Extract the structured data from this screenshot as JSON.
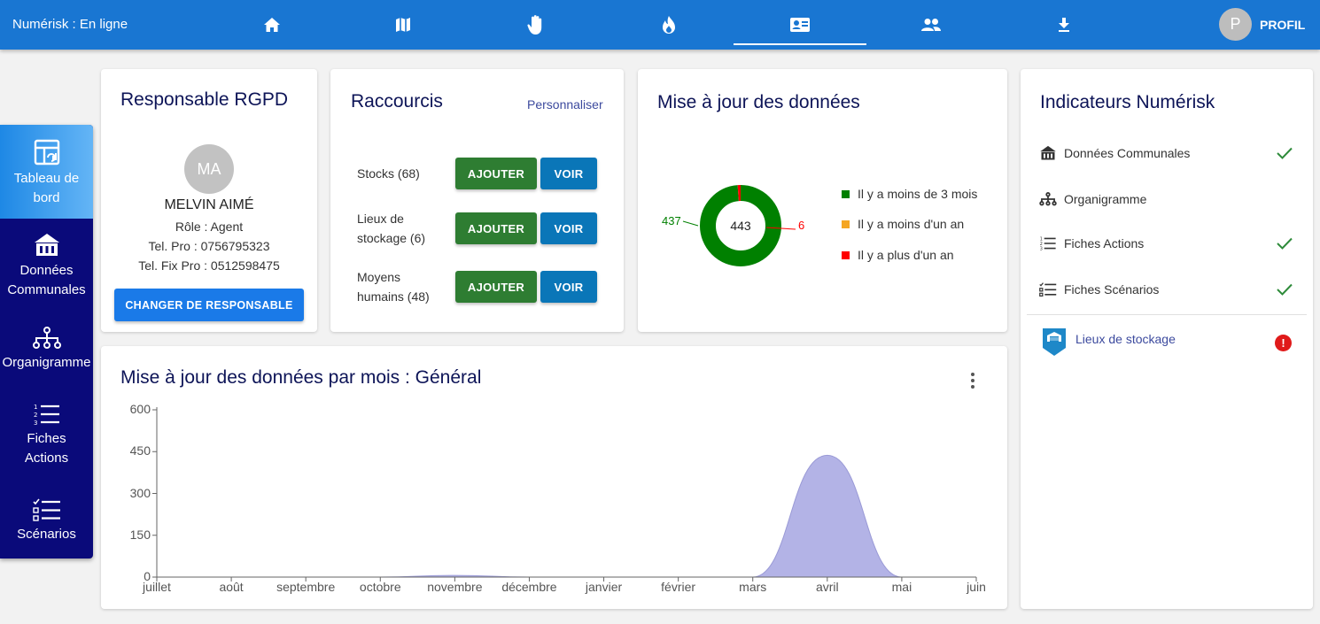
{
  "topbar": {
    "status": "Numérisk : En ligne",
    "profile_initial": "P",
    "profile_label": "PROFIL",
    "tabs": [
      {
        "icon": "home-icon"
      },
      {
        "icon": "map-icon"
      },
      {
        "icon": "hand-icon"
      },
      {
        "icon": "fire-icon"
      },
      {
        "icon": "contact-card-icon",
        "active": true
      },
      {
        "icon": "people-icon"
      },
      {
        "icon": "download-icon"
      }
    ]
  },
  "sidebar": {
    "items": [
      {
        "label": "Tableau de bord",
        "icon": "dashboard-icon",
        "active": true
      },
      {
        "label": "Données Communales",
        "icon": "town-hall-icon"
      },
      {
        "label": "Organigramme",
        "icon": "org-chart-icon"
      },
      {
        "label": "Fiches Actions",
        "icon": "numbered-list-icon"
      },
      {
        "label": "Scénarios",
        "icon": "checklist-icon"
      }
    ]
  },
  "rgpd": {
    "title": "Responsable RGPD",
    "initials": "MA",
    "name": "MELVIN AIMÉ",
    "role": "Rôle : Agent",
    "tel_pro": "Tel. Pro : 0756795323",
    "tel_fix": "Tel. Fix Pro : 0512598475",
    "button": "CHANGER DE RESPONSABLE"
  },
  "raccourcis": {
    "title": "Raccourcis",
    "personalize": "Personnaliser",
    "rows": [
      {
        "line1": "Stocks (68)",
        "line2": "",
        "add": "AJOUTER",
        "view": "VOIR"
      },
      {
        "line1": "Lieux de",
        "line2": "stockage (6)",
        "add": "AJOUTER",
        "view": "VOIR"
      },
      {
        "line1": "Moyens",
        "line2": "humains (48)",
        "add": "AJOUTER",
        "view": "VOIR"
      }
    ]
  },
  "maj": {
    "title": "Mise à jour des données",
    "total": "443",
    "label_left": "437",
    "label_right": "6",
    "legend": [
      {
        "label": "Il y a moins de 3 mois",
        "color": "#008000"
      },
      {
        "label": "Il y a moins d'un an",
        "color": "#f5a623"
      },
      {
        "label": "Il y a plus d'un an",
        "color": "#ff0000"
      }
    ],
    "values": [
      437,
      0,
      6
    ]
  },
  "indicateurs": {
    "title": "Indicateurs Numérisk",
    "rows": [
      {
        "label": "Données Communales",
        "icon": "town-hall-icon",
        "status": "check"
      },
      {
        "label": "Organigramme",
        "icon": "org-chart-icon",
        "status": ""
      },
      {
        "label": "Fiches Actions",
        "icon": "numbered-list-icon",
        "status": "check"
      },
      {
        "label": "Fiches Scénarios",
        "icon": "checklist-icon",
        "status": "check"
      }
    ],
    "storage": {
      "label": "Lieux de stockage",
      "icon": "warehouse-icon",
      "status": "alert",
      "alert_symbol": "!"
    }
  },
  "monthly": {
    "title": "Mise à jour des données par mois : Général",
    "menu_icon": "more-vert-icon"
  },
  "chart_data": {
    "type": "area",
    "title": "Mise à jour des données par mois : Général",
    "categories": [
      "juillet",
      "août",
      "septembre",
      "octobre",
      "novembre",
      "décembre",
      "janvier",
      "février",
      "mars",
      "avril",
      "mai",
      "juin"
    ],
    "series": [
      {
        "values": [
          0,
          0,
          0,
          0,
          6,
          0,
          0,
          0,
          0,
          437,
          0,
          0
        ],
        "color": "#b3b3e6"
      }
    ],
    "yticks": [
      "0",
      "150",
      "300",
      "450",
      "600"
    ],
    "ylim": [
      0,
      600
    ],
    "grid": false,
    "legend": "none"
  }
}
